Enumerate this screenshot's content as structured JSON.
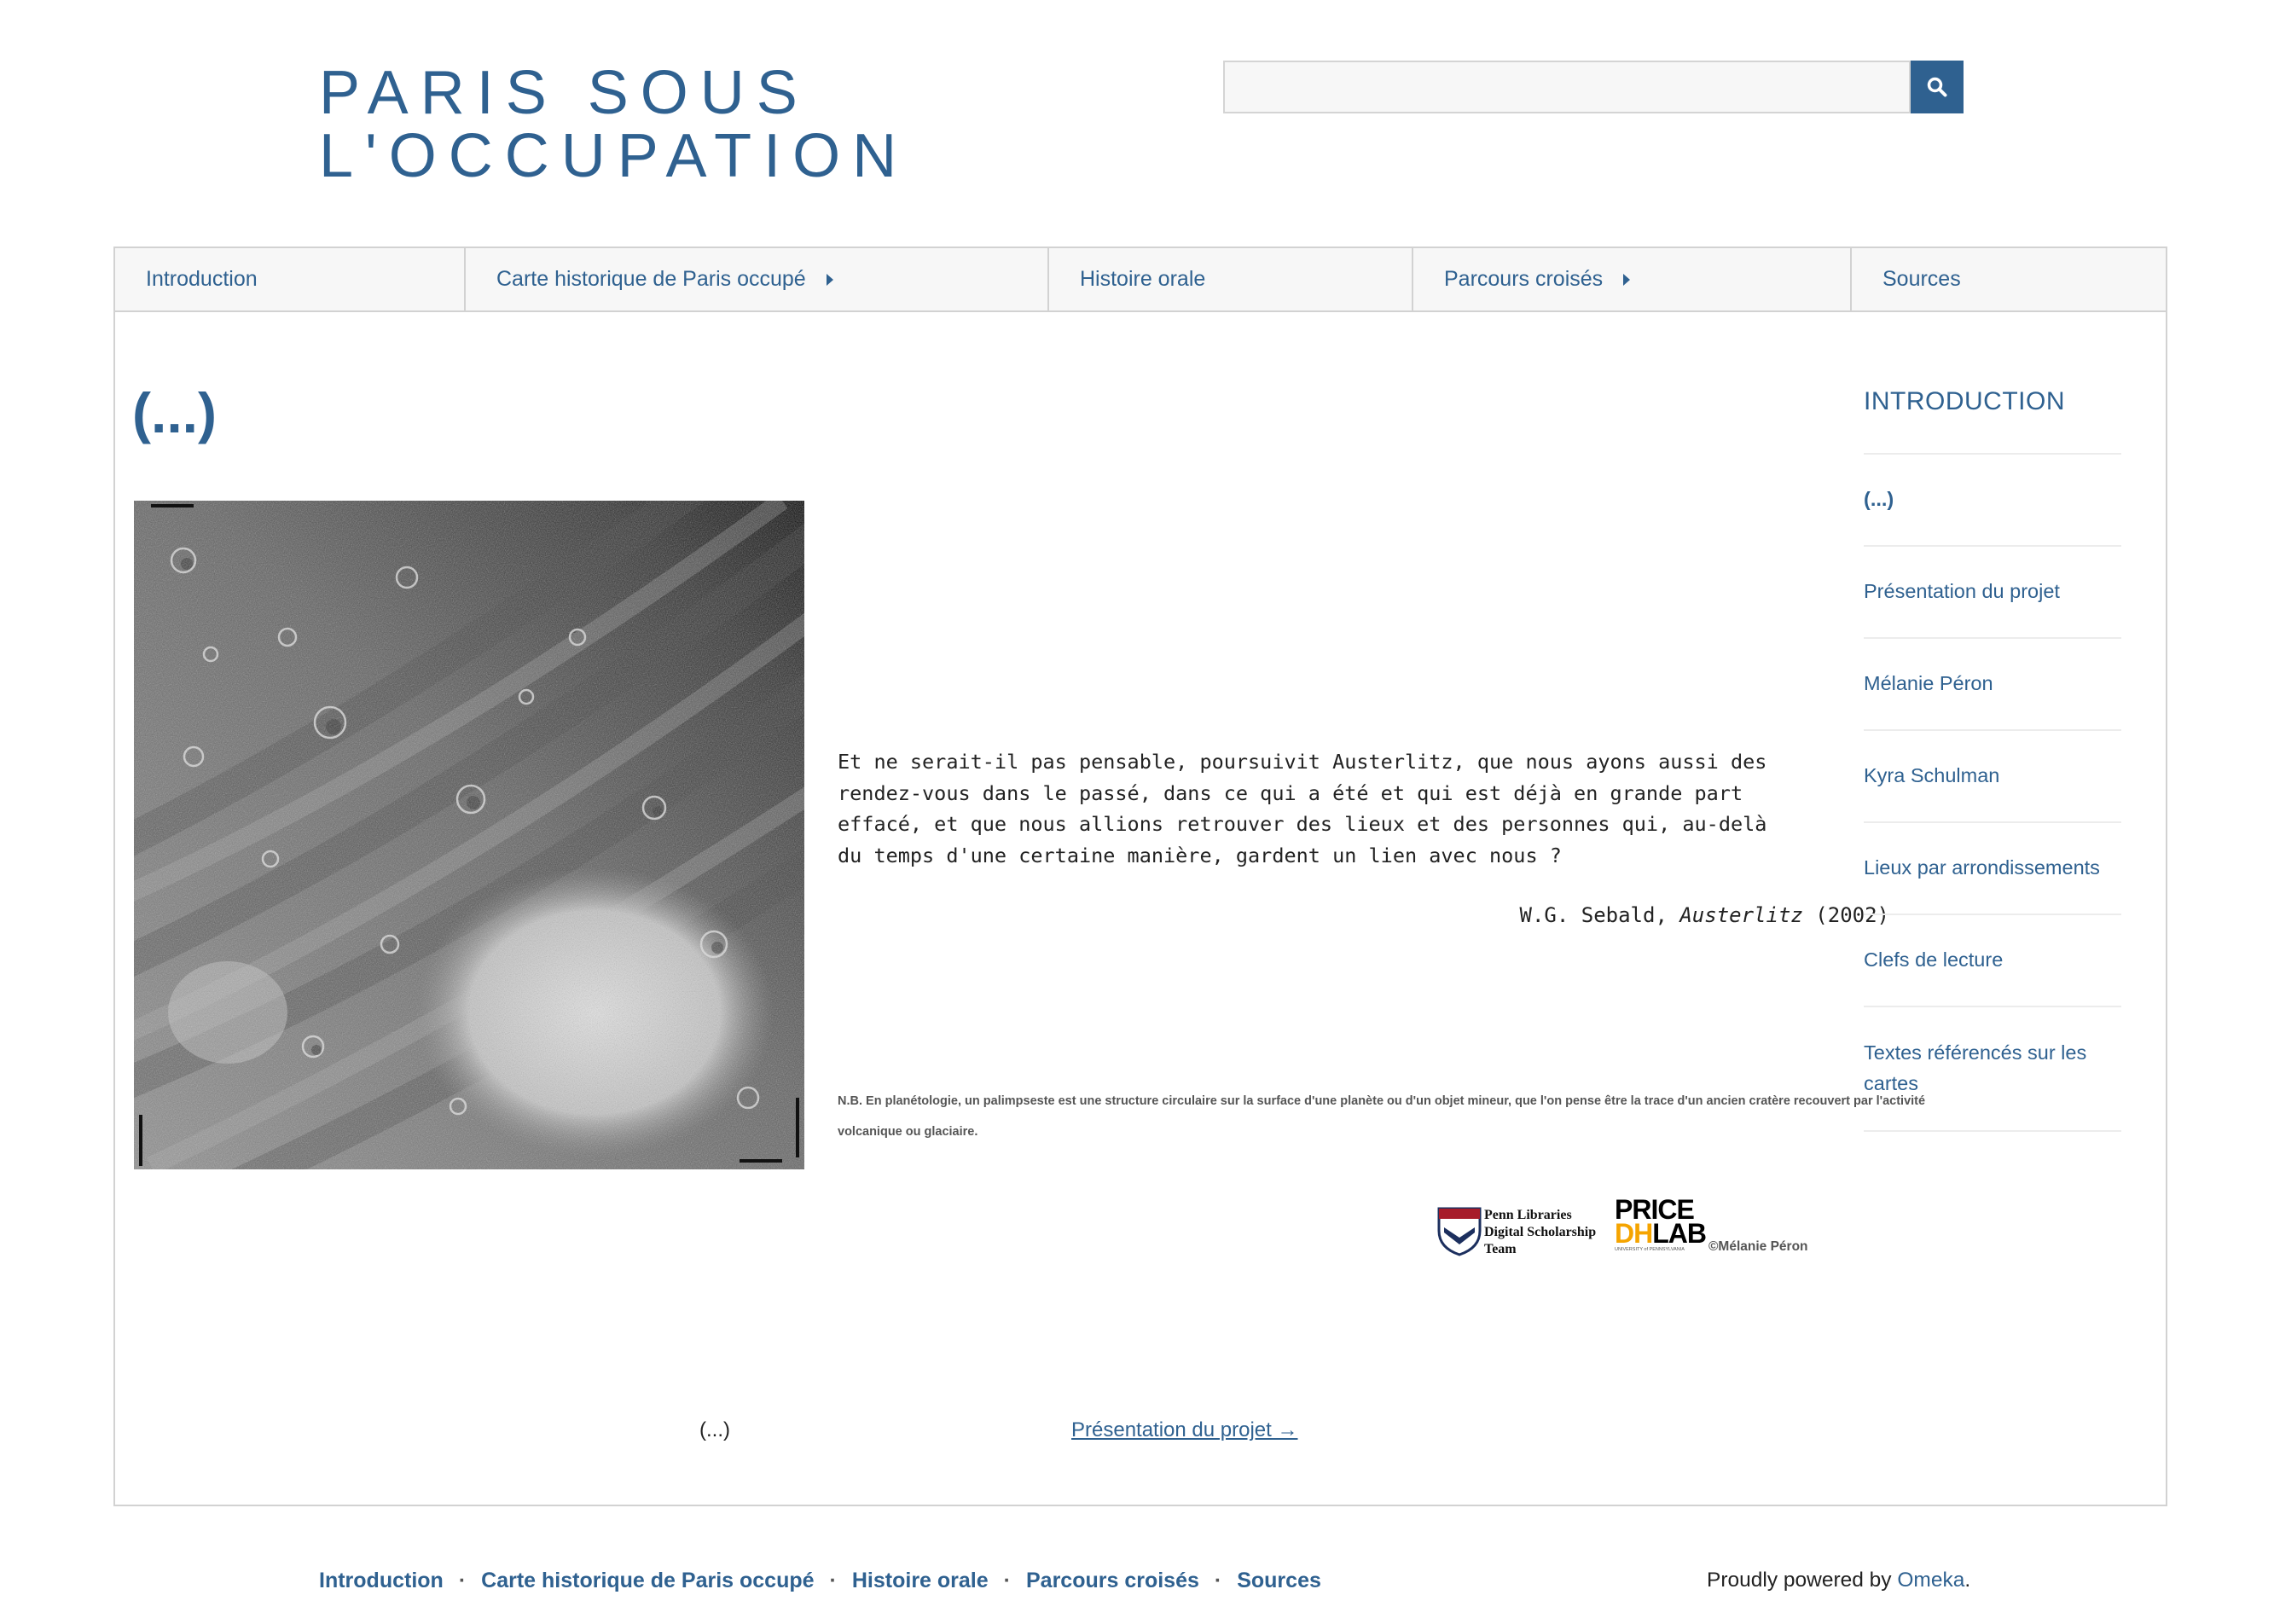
{
  "header": {
    "title_line1": "PARIS SOUS",
    "title_line2": "L'OCCUPATION",
    "search": {
      "value": "",
      "placeholder": "",
      "icon": "search-icon"
    }
  },
  "nav": {
    "items": [
      {
        "label": "Introduction",
        "has_submenu": false
      },
      {
        "label": "Carte historique de Paris occupé",
        "has_submenu": true
      },
      {
        "label": "Histoire orale",
        "has_submenu": false
      },
      {
        "label": "Parcours croisés",
        "has_submenu": true
      },
      {
        "label": "Sources",
        "has_submenu": false
      }
    ]
  },
  "page": {
    "heading": "(...)",
    "quote": "Et ne serait-il pas pensable, poursuivit Austerlitz, que nous ayons aussi des rendez-vous dans le passé, dans ce qui a été et qui est déjà en grande part effacé, et que nous allions retrouver des lieux et des personnes qui, au-delà du temps d'une certaine manière, gardent un lien avec nous ?",
    "quote_author": "W.G. Sebald,",
    "quote_work": "Austerlitz",
    "quote_year": "(2002)",
    "note": "N.B. En planétologie, un palimpseste est une structure circulaire sur la surface  d'une planète ou d'un objet mineur, que l'on pense être la trace d'un ancien cratère recouvert par l'activité volcanique ou glaciaire.",
    "logos": {
      "penn_line1": "Penn Libraries",
      "penn_line2": "Digital Scholarship",
      "penn_line3": "Team",
      "price": "PRICE",
      "dh": "DH",
      "lab": "LAB",
      "upenn": "UNIVERSITY of PENNSYLVANIA",
      "copyright": "©Mélanie Péron"
    },
    "prev_label": "(...)",
    "next_label": "Présentation du projet →"
  },
  "sidebar": {
    "heading": "INTRODUCTION",
    "items": [
      {
        "label": "(...)",
        "current": true
      },
      {
        "label": "Présentation du projet",
        "current": false
      },
      {
        "label": "Mélanie Péron",
        "current": false
      },
      {
        "label": "Kyra Schulman",
        "current": false
      },
      {
        "label": "Lieux par arrondissements",
        "current": false
      },
      {
        "label": "Clefs de lecture",
        "current": false
      },
      {
        "label": "Textes référencés sur les cartes",
        "current": false
      }
    ]
  },
  "footer": {
    "links": [
      "Introduction",
      "Carte historique de Paris occupé",
      "Histoire orale",
      "Parcours croisés",
      "Sources"
    ],
    "separator": "·",
    "powered_prefix": "Proudly powered by ",
    "powered_link": "Omeka",
    "powered_suffix": "."
  },
  "colors": {
    "accent": "#2f6190",
    "border": "#d2d2d2",
    "nav_bg": "#f7f7f7"
  }
}
